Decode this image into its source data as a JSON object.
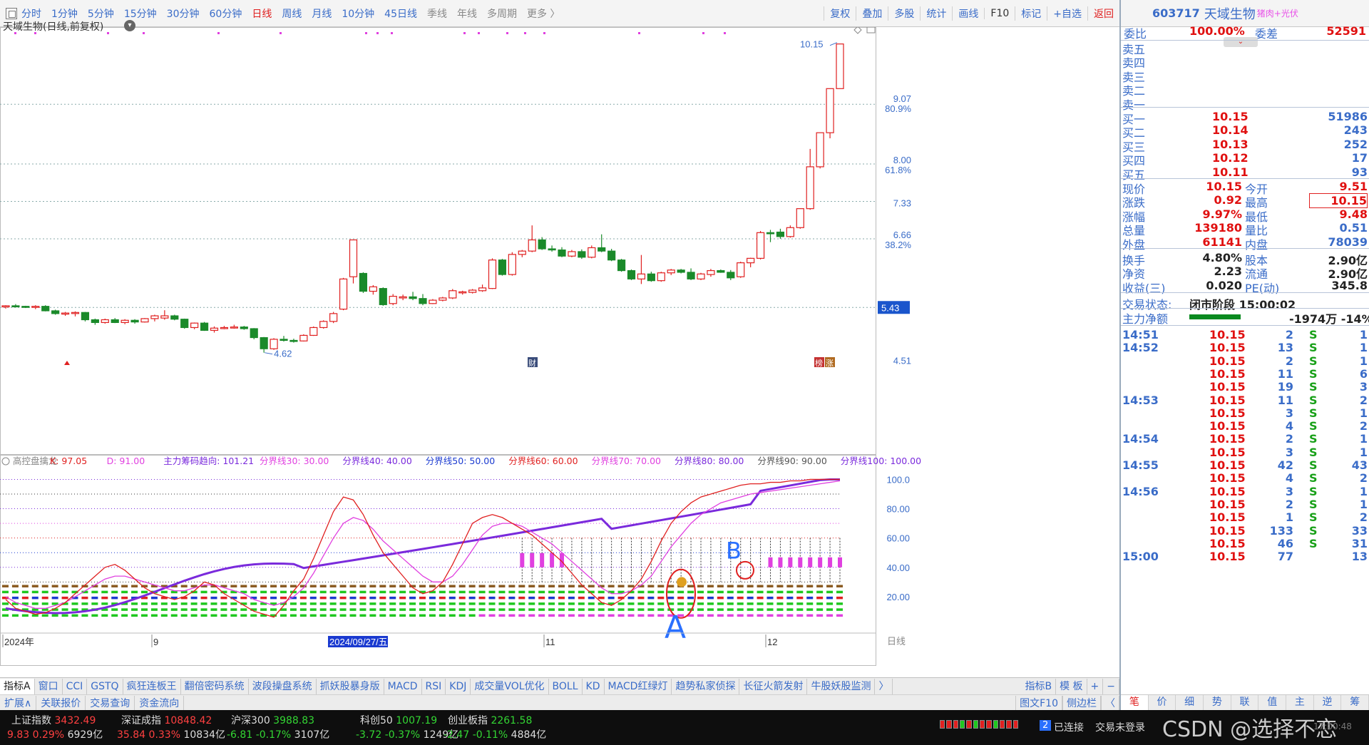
{
  "toolbar": {
    "periods": [
      "分时",
      "1分钟",
      "5分钟",
      "15分钟",
      "30分钟",
      "60分钟",
      "日线",
      "周线",
      "月线",
      "10分钟",
      "45日线",
      "季线",
      "年线",
      "多周期",
      "更多 〉"
    ],
    "active_period": "日线",
    "tools": [
      "复权",
      "叠加",
      "多股",
      "统计",
      "画线",
      "F10",
      "标记",
      "+自选",
      "返回"
    ]
  },
  "chart": {
    "title": "天域生物(日线,前复权)",
    "price_labels": [
      "9.07",
      "80.9%",
      "8.00",
      "61.8%",
      "7.33",
      "6.66",
      "38.2%",
      "5.43",
      "4.51"
    ],
    "high_label": "10.15",
    "low_label": "4.62",
    "markers": {
      "cai": "财",
      "bang": "榜",
      "zhang": "涨"
    },
    "date_labels": [
      "2024年",
      "9",
      "2024/09/27/五",
      "11",
      "12"
    ],
    "axis_corner": "日线",
    "annotations": {
      "a": "A",
      "b": "B"
    }
  },
  "chart_data": {
    "type": "candlestick",
    "title": "天域生物(日线,前复权)",
    "x_axis_labels": [
      "2024年",
      "9",
      "2024/09/27/五",
      "11",
      "12"
    ],
    "y_ticks": [
      4.51,
      5.43,
      6.66,
      7.33,
      8.0,
      9.07
    ],
    "fib_ticks": [
      "38.2%",
      "61.8%",
      "80.9%"
    ],
    "ylim": [
      4.45,
      10.35
    ],
    "candles": [
      [
        5.44,
        5.47,
        5.41,
        5.46
      ],
      [
        5.46,
        5.49,
        5.43,
        5.45
      ],
      [
        5.45,
        5.46,
        5.42,
        5.44
      ],
      [
        5.44,
        5.47,
        5.4,
        5.45
      ],
      [
        5.45,
        5.47,
        5.36,
        5.37
      ],
      [
        5.37,
        5.39,
        5.3,
        5.32
      ],
      [
        5.32,
        5.35,
        5.28,
        5.33
      ],
      [
        5.33,
        5.36,
        5.27,
        5.34
      ],
      [
        5.34,
        5.35,
        5.18,
        5.21
      ],
      [
        5.21,
        5.23,
        5.12,
        5.16
      ],
      [
        5.16,
        5.23,
        5.14,
        5.21
      ],
      [
        5.21,
        5.24,
        5.15,
        5.16
      ],
      [
        5.16,
        5.22,
        5.13,
        5.2
      ],
      [
        5.2,
        5.22,
        5.14,
        5.17
      ],
      [
        5.17,
        5.24,
        5.16,
        5.23
      ],
      [
        5.23,
        5.3,
        5.18,
        5.28
      ],
      [
        5.24,
        5.38,
        5.21,
        5.28
      ],
      [
        5.28,
        5.3,
        5.2,
        5.22
      ],
      [
        5.22,
        5.23,
        5.05,
        5.07
      ],
      [
        5.07,
        5.16,
        5.04,
        5.15
      ],
      [
        5.15,
        5.17,
        5.01,
        5.02
      ],
      [
        5.02,
        5.09,
        4.98,
        5.06
      ],
      [
        5.06,
        5.1,
        5.04,
        5.07
      ],
      [
        5.08,
        5.12,
        5.05,
        5.08
      ],
      [
        5.08,
        5.1,
        5.03,
        5.05
      ],
      [
        5.05,
        5.06,
        4.86,
        4.89
      ],
      [
        4.89,
        4.9,
        4.62,
        4.69
      ],
      [
        4.69,
        4.88,
        4.67,
        4.86
      ],
      [
        4.86,
        4.92,
        4.82,
        4.84
      ],
      [
        4.84,
        4.87,
        4.8,
        4.83
      ],
      [
        4.83,
        4.95,
        4.82,
        4.93
      ],
      [
        4.93,
        5.09,
        4.92,
        5.07
      ],
      [
        5.07,
        5.2,
        5.05,
        5.18
      ],
      [
        5.18,
        5.35,
        5.15,
        5.32
      ],
      [
        5.4,
        5.96,
        5.38,
        5.94
      ],
      [
        5.98,
        6.64,
        5.86,
        6.64
      ],
      [
        6.04,
        6.06,
        5.69,
        5.72
      ],
      [
        5.72,
        5.83,
        5.66,
        5.8
      ],
      [
        5.77,
        5.79,
        5.46,
        5.48
      ],
      [
        5.5,
        5.67,
        5.47,
        5.63
      ],
      [
        5.6,
        5.66,
        5.56,
        5.62
      ],
      [
        5.62,
        5.71,
        5.56,
        5.59
      ],
      [
        5.59,
        5.67,
        5.47,
        5.5
      ],
      [
        5.5,
        5.58,
        5.49,
        5.56
      ],
      [
        5.56,
        5.62,
        5.54,
        5.6
      ],
      [
        5.6,
        5.76,
        5.58,
        5.73
      ],
      [
        5.7,
        5.73,
        5.66,
        5.71
      ],
      [
        5.7,
        5.76,
        5.68,
        5.74
      ],
      [
        5.73,
        5.84,
        5.71,
        5.78
      ],
      [
        5.77,
        6.31,
        5.76,
        6.28
      ],
      [
        6.28,
        6.3,
        6.0,
        6.02
      ],
      [
        6.02,
        6.42,
        6.0,
        6.38
      ],
      [
        6.38,
        6.46,
        6.33,
        6.44
      ],
      [
        6.44,
        6.9,
        6.42,
        6.64
      ],
      [
        6.64,
        6.69,
        6.46,
        6.48
      ],
      [
        6.48,
        6.54,
        6.43,
        6.46
      ],
      [
        6.46,
        6.51,
        6.33,
        6.35
      ],
      [
        6.35,
        6.46,
        6.33,
        6.43
      ],
      [
        6.43,
        6.47,
        6.3,
        6.33
      ],
      [
        6.33,
        6.54,
        6.31,
        6.5
      ],
      [
        6.5,
        6.74,
        6.42,
        6.44
      ],
      [
        6.44,
        6.48,
        6.26,
        6.28
      ],
      [
        6.28,
        6.3,
        6.07,
        6.09
      ],
      [
        6.09,
        6.11,
        5.92,
        5.94
      ],
      [
        5.94,
        6.37,
        5.85,
        6.03
      ],
      [
        6.03,
        6.07,
        5.89,
        5.91
      ],
      [
        5.91,
        6.07,
        5.89,
        6.05
      ],
      [
        6.05,
        6.12,
        6.01,
        6.1
      ],
      [
        6.1,
        6.12,
        6.04,
        6.06
      ],
      [
        6.06,
        6.13,
        5.92,
        5.94
      ],
      [
        5.94,
        6.05,
        5.92,
        6.03
      ],
      [
        6.02,
        6.12,
        5.98,
        6.09
      ],
      [
        6.09,
        6.11,
        6.05,
        6.06
      ],
      [
        6.06,
        6.1,
        5.92,
        5.96
      ],
      [
        5.98,
        6.25,
        5.96,
        6.23
      ],
      [
        6.23,
        6.32,
        6.15,
        6.31
      ],
      [
        6.31,
        6.8,
        6.29,
        6.77
      ],
      [
        6.77,
        6.82,
        6.6,
        6.75
      ],
      [
        6.78,
        6.84,
        6.66,
        6.7
      ],
      [
        6.7,
        6.9,
        6.68,
        6.86
      ],
      [
        6.86,
        7.2,
        6.84,
        7.2
      ],
      [
        7.2,
        8.27,
        7.18,
        7.95
      ],
      [
        7.95,
        8.36,
        7.92,
        8.56
      ],
      [
        8.56,
        9.35,
        8.46,
        9.35
      ],
      [
        9.35,
        10.15,
        9.35,
        10.15
      ]
    ],
    "indicator": {
      "name": "高控盘擒龙",
      "K": 97.05,
      "D": 91.0,
      "main_force_trend": 101.21,
      "levels": [
        30,
        40,
        50,
        60,
        70,
        80,
        90,
        100
      ],
      "ylim": [
        0,
        108
      ],
      "y_ticks": [
        20.0,
        40.0,
        60.0,
        80.0,
        100.0
      ]
    }
  },
  "indicator_header": {
    "name": "高控盘擒龙",
    "k": "K: 97.05",
    "d": "D: 91.00",
    "trend": "主力筹码趋向: 101.21",
    "levels": [
      "分界线30: 30.00",
      "分界线40: 40.00",
      "分界线50: 50.00",
      "分界线60: 60.00",
      "分界线70: 70.00",
      "分界线80: 80.00",
      "分界线90: 90.00",
      "分界线100: 100.00"
    ],
    "ticks": [
      "100.0",
      "80.00",
      "60.00",
      "40.00",
      "20.00"
    ]
  },
  "tabs": [
    "指标A",
    "窗口",
    "CCI",
    "GSTQ",
    "疯狂连板王",
    "翻倍密码系统",
    "波段操盘系统",
    "抓妖股暴身版",
    "MACD",
    "RSI",
    "KDJ",
    "成交量VOL优化",
    "BOLL",
    "KD",
    "MACD红绿灯",
    "趋势私家侦探",
    "长征火箭发射",
    "牛股妖股监测",
    "〉"
  ],
  "tabs_right": [
    "指标B",
    "模 板",
    "+",
    "−"
  ],
  "tabs2": [
    "扩展∧",
    "关联报价",
    "交易查询",
    "资金流向"
  ],
  "tabs2_right": [
    "图文F10",
    "侧边栏",
    "〈"
  ],
  "status": {
    "indices": [
      {
        "name": "上证指数",
        "value": "3432.49",
        "chg": "9.83",
        "pct": "0.29%",
        "amt": "6929亿",
        "dir": "up"
      },
      {
        "name": "深证成指",
        "value": "10848.42",
        "chg": "35.84",
        "pct": "0.33%",
        "amt": "10834亿",
        "dir": "up"
      },
      {
        "name": "沪深300",
        "value": "3988.83",
        "chg": "-6.81",
        "pct": "-0.17%",
        "amt": "3107亿",
        "dir": "dn"
      },
      {
        "name": "科创50",
        "value": "1007.19",
        "chg": "-3.72",
        "pct": "-0.37%",
        "amt": "1249亿",
        "dir": "dn"
      },
      {
        "name": "创业板指",
        "value": "2261.58",
        "chg": "-2.47",
        "pct": "-0.11%",
        "amt": "4884亿",
        "dir": "dn"
      }
    ],
    "connected": "已连接",
    "trade": "交易未登录",
    "badge": "2",
    "watermark": "CSDN @选择不恋",
    "time": "17:00:48"
  },
  "panel": {
    "code": "603717",
    "name": "天域生物",
    "tag": "猪肉+光伏",
    "weibi_label": "委比",
    "weibi_value": "100.00%",
    "weicha_label": "委差",
    "weicha_value": "52591",
    "sell_labels": [
      "卖五",
      "卖四",
      "卖三",
      "卖二",
      "卖一"
    ],
    "buys": [
      {
        "label": "买一",
        "price": "10.15",
        "vol": "51986"
      },
      {
        "label": "买二",
        "price": "10.14",
        "vol": "243"
      },
      {
        "label": "买三",
        "price": "10.13",
        "vol": "252"
      },
      {
        "label": "买四",
        "price": "10.12",
        "vol": "17"
      },
      {
        "label": "买五",
        "price": "10.11",
        "vol": "93"
      }
    ],
    "quotes": [
      {
        "l1": "现价",
        "v1": "10.15",
        "l2": "今开",
        "v2": "9.51"
      },
      {
        "l1": "涨跌",
        "v1": "0.92",
        "l2": "最高",
        "v2": "10.15"
      },
      {
        "l1": "涨幅",
        "v1": "9.97%",
        "l2": "最低",
        "v2": "9.48"
      },
      {
        "l1": "总量",
        "v1": "139180",
        "l2": "量比",
        "v2": "0.51"
      },
      {
        "l1": "外盘",
        "v1": "61141",
        "l2": "内盘",
        "v2": "78039"
      }
    ],
    "fund": [
      {
        "l1": "换手",
        "v1": "4.80%",
        "l2": "股本",
        "v2": "2.90亿"
      },
      {
        "l1": "净资",
        "v1": "2.23",
        "l2": "流通",
        "v2": "2.90亿"
      },
      {
        "l1": "收益(三)",
        "v1": "0.020",
        "l2": "PE(动)",
        "v2": "345.8"
      }
    ],
    "trade_state_label": "交易状态:",
    "trade_state": "闭市阶段 15:00:02",
    "net_label": "主力净额",
    "net_value": "-1974万",
    "net_pct": "-14%",
    "net_ratio": 0.55,
    "ticks": [
      {
        "t": "14:51",
        "p": "10.15",
        "v": "2",
        "s": "S",
        "n": "1"
      },
      {
        "t": "14:52",
        "p": "10.15",
        "v": "13",
        "s": "S",
        "n": "1"
      },
      {
        "t": "",
        "p": "10.15",
        "v": "2",
        "s": "S",
        "n": "1"
      },
      {
        "t": "",
        "p": "10.15",
        "v": "11",
        "s": "S",
        "n": "6"
      },
      {
        "t": "",
        "p": "10.15",
        "v": "19",
        "s": "S",
        "n": "3"
      },
      {
        "t": "14:53",
        "p": "10.15",
        "v": "11",
        "s": "S",
        "n": "2"
      },
      {
        "t": "",
        "p": "10.15",
        "v": "3",
        "s": "S",
        "n": "1"
      },
      {
        "t": "",
        "p": "10.15",
        "v": "4",
        "s": "S",
        "n": "2"
      },
      {
        "t": "14:54",
        "p": "10.15",
        "v": "2",
        "s": "S",
        "n": "1"
      },
      {
        "t": "",
        "p": "10.15",
        "v": "3",
        "s": "S",
        "n": "1"
      },
      {
        "t": "14:55",
        "p": "10.15",
        "v": "42",
        "s": "S",
        "n": "43"
      },
      {
        "t": "",
        "p": "10.15",
        "v": "4",
        "s": "S",
        "n": "2"
      },
      {
        "t": "14:56",
        "p": "10.15",
        "v": "3",
        "s": "S",
        "n": "1"
      },
      {
        "t": "",
        "p": "10.15",
        "v": "2",
        "s": "S",
        "n": "1"
      },
      {
        "t": "",
        "p": "10.15",
        "v": "1",
        "s": "S",
        "n": "2"
      },
      {
        "t": "",
        "p": "10.15",
        "v": "133",
        "s": "S",
        "n": "33"
      },
      {
        "t": "",
        "p": "10.15",
        "v": "46",
        "s": "S",
        "n": "31"
      },
      {
        "t": "15:00",
        "p": "10.15",
        "v": "77",
        "s": "",
        "n": "13"
      }
    ],
    "bottom_tabs": [
      "笔",
      "价",
      "细",
      "势",
      "联",
      "值",
      "主",
      "逆",
      "筹"
    ]
  }
}
